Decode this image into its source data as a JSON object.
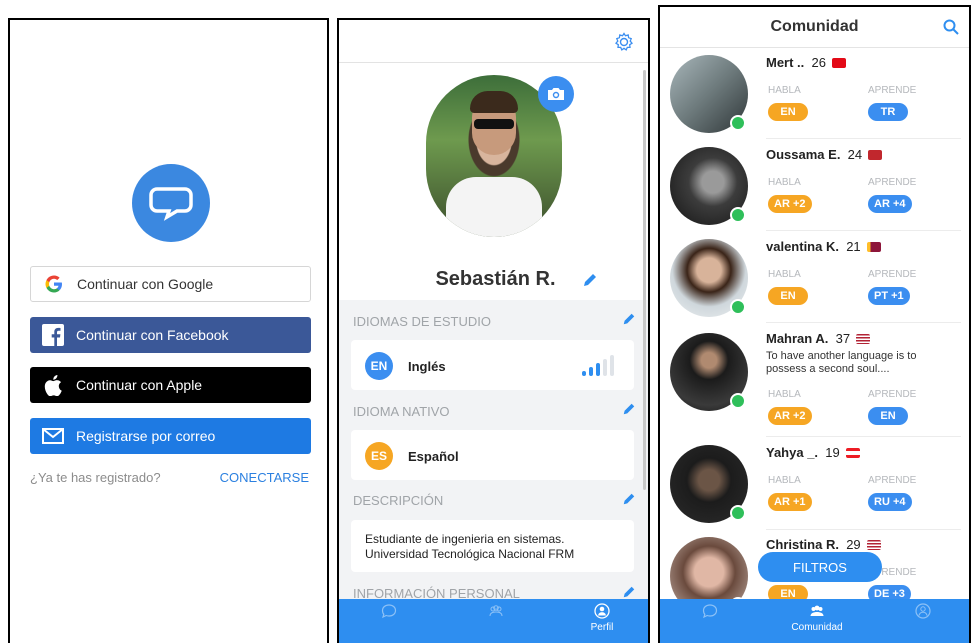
{
  "login": {
    "google_label": "Continuar con Google",
    "facebook_label": "Continuar con Facebook",
    "apple_label": "Continuar con Apple",
    "email_label": "Registrarse por correo",
    "already_registered": "¿Ya te has registrado?",
    "connect_link": "CONECTARSE"
  },
  "profile": {
    "name": "Sebastián R.",
    "study_languages_title": "IDIOMAS DE ESTUDIO",
    "study_language": {
      "code": "EN",
      "name": "Inglés",
      "level": 3,
      "level_max": 5
    },
    "native_title": "IDIOMA NATIVO",
    "native_language": {
      "code": "ES",
      "name": "Español"
    },
    "description_title": "DESCRIPCIÓN",
    "description": "Estudiante de ingenieria en sistemas.\nUniversidad Tecnológica Nacional FRM",
    "personal_info_title": "INFORMACIÓN PERSONAL",
    "tabs": [
      {
        "label": ""
      },
      {
        "label": ""
      },
      {
        "label": "Perfil"
      }
    ]
  },
  "community": {
    "title": "Comunidad",
    "speaks_label": "HABLA",
    "learns_label": "APRENDE",
    "users": [
      {
        "name": "Mert ..",
        "age": "26",
        "speaks": "EN",
        "learns": "TR",
        "bio": ""
      },
      {
        "name": "Oussama E.",
        "age": "24",
        "speaks": "AR +2",
        "learns": "AR +4",
        "bio": ""
      },
      {
        "name": "valentina K.",
        "age": "21",
        "speaks": "EN",
        "learns": "PT +1",
        "bio": ""
      },
      {
        "name": "Mahran A.",
        "age": "37",
        "speaks": "AR +2",
        "learns": "EN",
        "bio": "To have another language is to possess a second soul...."
      },
      {
        "name": "Yahya _.",
        "age": "19",
        "speaks": "AR +1",
        "learns": "RU +4",
        "bio": ""
      },
      {
        "name": "Christina R.",
        "age": "29",
        "speaks": "EN",
        "learns": "DE +3",
        "bio": ""
      }
    ],
    "filters_label": "FILTROS",
    "tabs": [
      {
        "label": ""
      },
      {
        "label": "Comunidad"
      },
      {
        "label": ""
      }
    ]
  },
  "colors": {
    "accent": "#2e8ef0",
    "facebook": "#3b5898",
    "email": "#1e7ae3",
    "orange": "#f6a623",
    "online": "#2fbf5a"
  }
}
